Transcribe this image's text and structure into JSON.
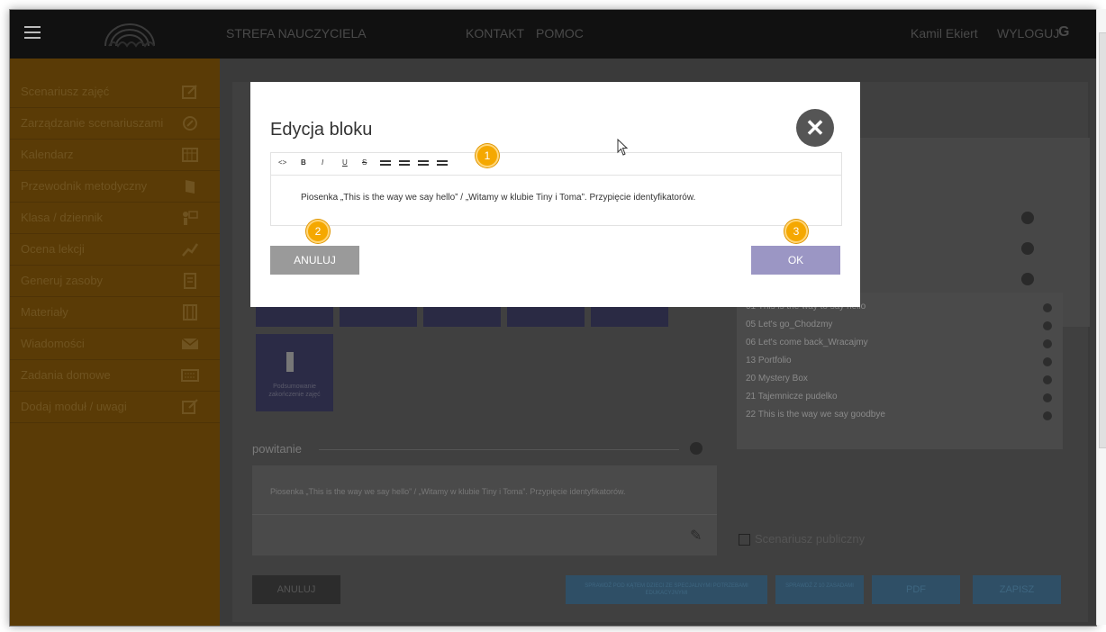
{
  "topbar": {
    "nav": [
      "STREFA NAUCZYCIELA",
      "KONTAKT",
      "POMOC"
    ],
    "user": "Kamil Ekiert",
    "logout": "WYLOGUJ"
  },
  "sidebar": {
    "items": [
      "Scenariusz zajęć",
      "Zarządzanie scenariuszami",
      "Kalendarz",
      "Przewodnik metodyczny",
      "Klasa / dziennik",
      "Ocena lekcji",
      "Generuj zasoby",
      "Materiały",
      "Wiadomości",
      "Zadania domowe",
      "Dodaj moduł / uwagi"
    ]
  },
  "background": {
    "tile_caption": "Podsumowanie zakończenie zajęć",
    "section_title": "powitanie",
    "section_text": "Piosenka „This is the way we say hello” / „Witamy w klubie Tiny i Toma”. Przypięcie identyfikatorów.",
    "list": [
      "01 This is the way to say hello",
      "05 Let's go_Chodzmy",
      "06 Let's come back_Wracajmy",
      "13 Portfolio",
      "20 Mystery Box",
      "21 Tajemnicze pudelko",
      "22 This is the way we say goodbye"
    ],
    "checkbox_label": "Scenariusz publiczny",
    "bottom_buttons": [
      "ANULUJ",
      "SPRAWDŹ POD KĄTEM DZIECI ZE SPECJALNYMI POTRZEBAMI EDUKACYJNYMI",
      "SPRAWDŹ Z 10 ZASADAMI",
      "PDF",
      "ZAPISZ"
    ]
  },
  "modal": {
    "title": "Edycja bloku",
    "editor_text": "Piosenka „This is the way we say hello” / „Witamy w klubie Tiny i Toma”. Przypięcie identyfikatorów.",
    "toolbar": [
      "<>",
      "B",
      "I",
      "U",
      "S",
      "ul",
      "ol",
      "outdent",
      "indent"
    ],
    "cancel": "ANULUJ",
    "ok": "OK",
    "badges": [
      "1",
      "2",
      "3"
    ]
  }
}
